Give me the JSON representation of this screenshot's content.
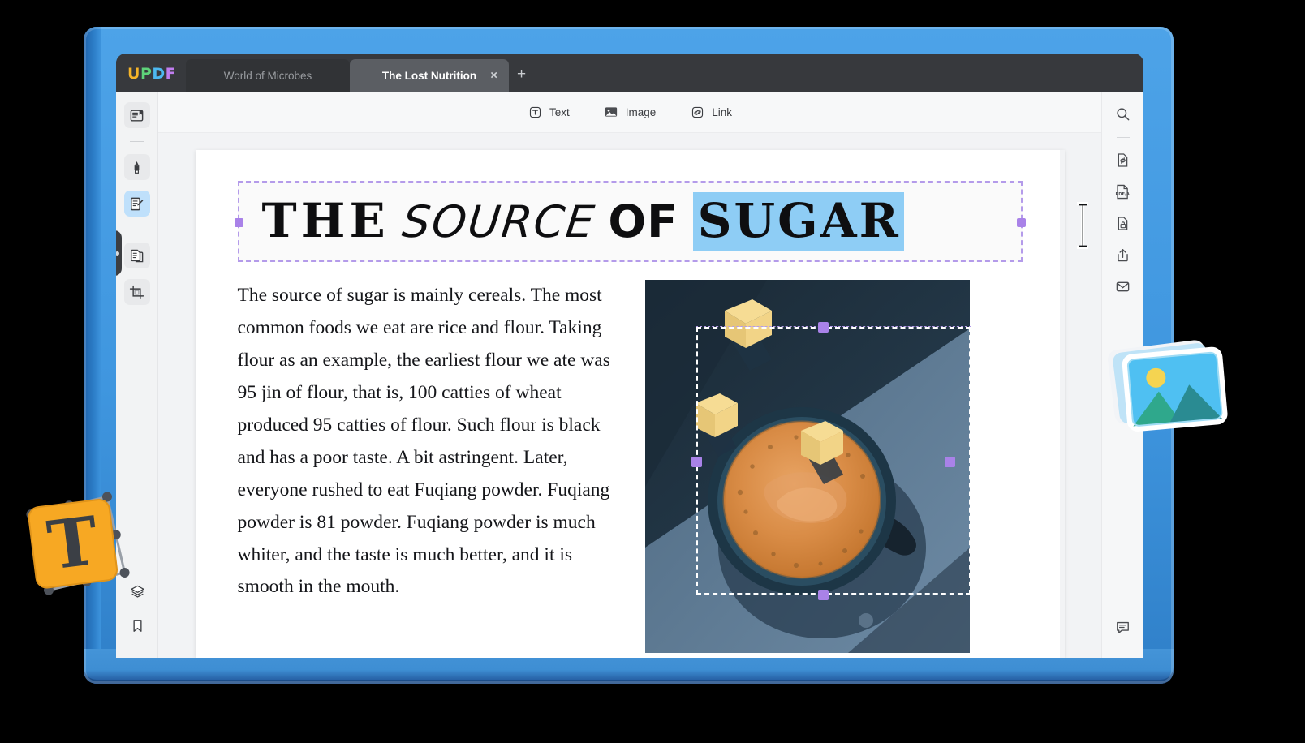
{
  "app": {
    "logo_letters": [
      "U",
      "P",
      "D",
      "F"
    ],
    "tabs": [
      {
        "label": "World of Microbes",
        "active": false
      },
      {
        "label": "The Lost Nutrition",
        "active": true,
        "close": "×"
      }
    ],
    "new_tab_label": "+"
  },
  "edit_toolbar": {
    "items": [
      {
        "label": "Text",
        "icon": "text-box-icon"
      },
      {
        "label": "Image",
        "icon": "image-icon"
      },
      {
        "label": "Link",
        "icon": "link-icon"
      }
    ]
  },
  "left_rail": {
    "items": [
      {
        "name": "reader-view",
        "icon": "book-reader-icon",
        "active": false
      },
      {
        "name": "annotate",
        "icon": "highlighter-icon",
        "active": false
      },
      {
        "name": "edit-pdf",
        "icon": "edit-document-icon",
        "active": true
      },
      {
        "name": "organize-pages",
        "icon": "pages-copy-icon",
        "active": false
      },
      {
        "name": "crop-page",
        "icon": "crop-icon",
        "active": false
      }
    ],
    "bottom_items": [
      {
        "name": "layers",
        "icon": "layers-icon"
      },
      {
        "name": "bookmarks",
        "icon": "bookmark-icon"
      }
    ]
  },
  "right_rail": {
    "items": [
      {
        "name": "search",
        "icon": "search-icon"
      },
      {
        "name": "convert-pdf",
        "icon": "convert-file-icon"
      },
      {
        "name": "pdf-a",
        "icon": "pdfa-icon",
        "label": "PDF/A"
      },
      {
        "name": "protect",
        "icon": "lock-file-icon"
      },
      {
        "name": "share",
        "icon": "share-upload-icon"
      },
      {
        "name": "email",
        "icon": "envelope-icon"
      }
    ],
    "bottom_items": [
      {
        "name": "comments",
        "icon": "comment-icon"
      }
    ]
  },
  "document": {
    "heading": {
      "part1": "THE",
      "part2": "SOURCE",
      "part3": "OF",
      "part4_selected": "SUGAR",
      "selection_color": "#8ecdf5",
      "selection_box_color": "#b49bea"
    },
    "body_text": "The source of sugar is mainly cereals. The most common foods we eat are rice and flour. Taking flour as an example, the earliest flour we ate was 95 jin of flour, that is, 100 catties of wheat produced 95 catties of flour. Such flour is black and has a poor taste. A bit astringent. Later, everyone rushed to eat Fuqiang powder. Fuqiang powder is 81 powder. Fuqiang powder is much whiter, and the taste is much better, and it is smooth in the mouth.",
    "image": {
      "name": "coffee-cup-with-sugar-cubes",
      "selected": true,
      "handle_color": "#a982e8"
    }
  },
  "decorations": {
    "text_badge": {
      "name": "text-tool-badge",
      "glyph": "T",
      "color": "#f7a823"
    },
    "image_badge": {
      "name": "image-tool-badge",
      "color": "#46b9f0"
    }
  },
  "theme": {
    "device_blue": "#3f96df",
    "titlebar": "#37393d",
    "active_tab": "#5b5e63",
    "accent_purple": "#a982e8",
    "highlight_blue": "#8ecdf5"
  }
}
